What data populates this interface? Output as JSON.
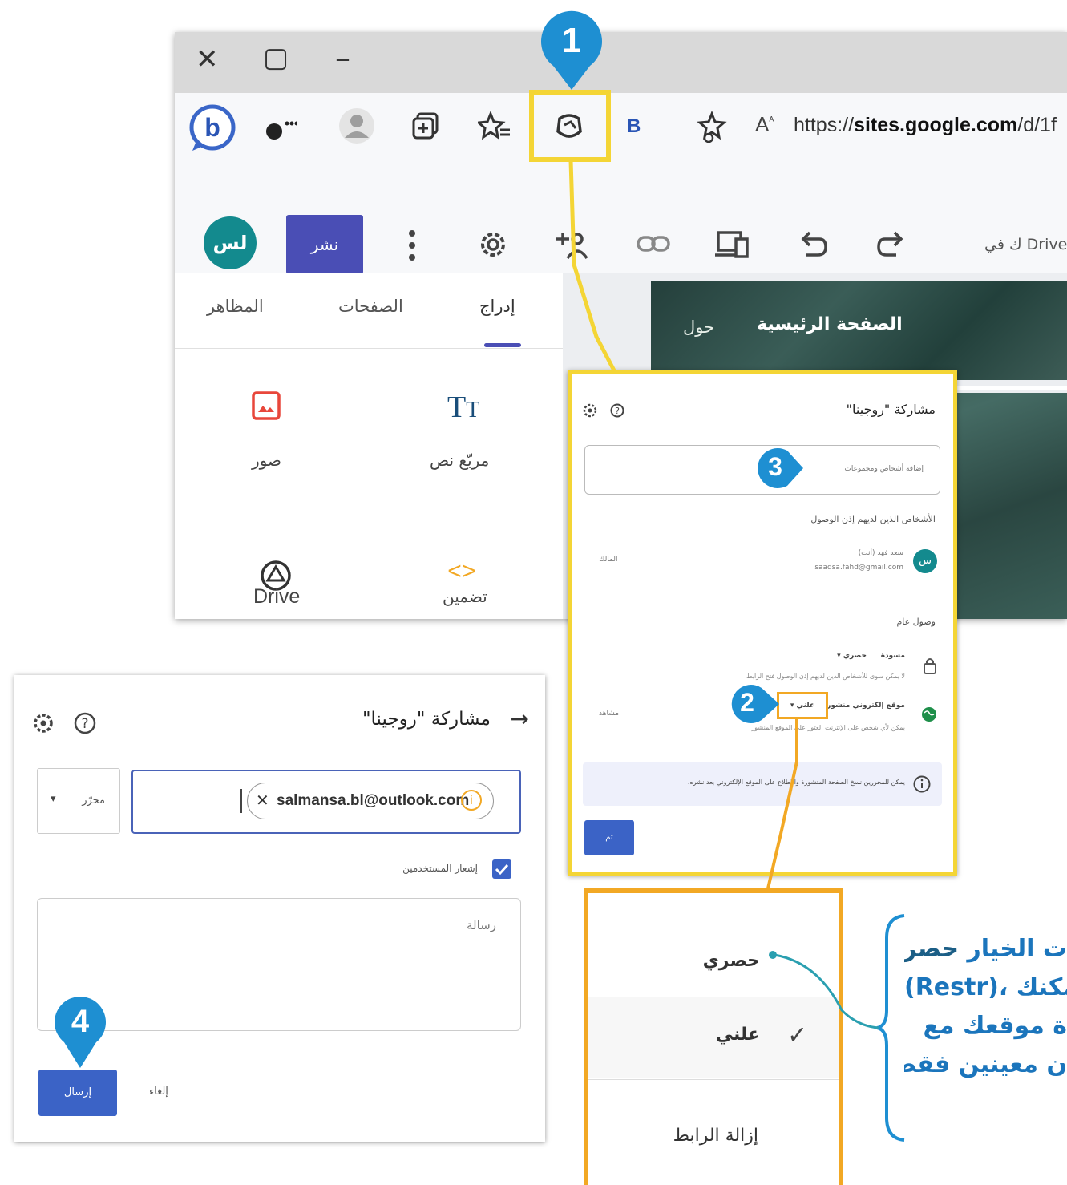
{
  "window_controls": {
    "close": "✕",
    "maximize": "▢",
    "minimize": "–"
  },
  "browser": {
    "url_prefix": "https://",
    "url_domain": "sites.google.com",
    "url_rest": "/d/1f",
    "read_aloud": "A",
    "bing_b": "B"
  },
  "editor": {
    "avatar": "لس",
    "publish_label": "نشر",
    "drive_status": "ك في Drive"
  },
  "panel_tabs": {
    "themes": "المظاهر",
    "pages": "الصفحات",
    "insert": "إدراج"
  },
  "insert_items": {
    "images": "صور",
    "text_box": "مربّع نص",
    "drive": "Drive",
    "embed": "تضمين"
  },
  "site_nav": {
    "home": "الصفحة الرئيسية",
    "about": "حول"
  },
  "share_dialog": {
    "title": "مشاركة \"روجينا\"",
    "add_placeholder": "إضافة أشخاص ومجموعات",
    "people_heading": "الأشخاص الذين لديهم إذن الوصول",
    "person_name": "سعد فهد (أنت)",
    "person_email": "saadsa.fahd@gmail.com",
    "person_role": "المالك",
    "person_initials": "س",
    "general_heading": "وصول عام",
    "draft_label": "مسودة",
    "draft_value": "حصري",
    "draft_desc": "لا يمكن سوى للأشخاص الذين لديهم إذن الوصول فتح الرابط",
    "published_label": "موقع إلكتروني منشور",
    "published_value": "علني",
    "published_desc": "يمكن لأي شخص على الإنترنت العثور على الموقع المنشور",
    "viewer_role": "مشاهد",
    "info_text": "يمكن للمحررين نسخ الصفحة المنشورة والاطلاع على الموقع الإلكتروني بعد نشره.",
    "done_label": "تم"
  },
  "dropdown": {
    "restricted": "حصري",
    "public": "علني",
    "remove_link": "إزالة الرابط"
  },
  "invite_dialog": {
    "title": "مشاركة \"روجينا\"",
    "role": "محرّر",
    "email_chip": "salmansa.bl@outlook.com",
    "notify_label": "إشعار المستخدمين",
    "message_placeholder": "رسالة",
    "send_label": "إرسال",
    "cancel_label": "إلغاء"
  },
  "steps": {
    "one": "1",
    "two": "2",
    "three": "3",
    "four": "4"
  },
  "callout": {
    "line1_prefix": "ت الخيار ",
    "line1_strong": "حصري",
    "line2": "(Restr)، يمكنك",
    "line3": "ة موقعك مع",
    "line4": "ن معينين فقط."
  },
  "colors": {
    "yellow_highlight": "#f4d535",
    "orange_highlight": "#f2a824",
    "step_blue": "#1e8fd2",
    "publish_purple": "#4a4eb5",
    "send_blue": "#3b63c6",
    "avatar_teal": "#138a8e",
    "header_green": "#2d4b46",
    "callout_blue": "#1b75bc"
  }
}
